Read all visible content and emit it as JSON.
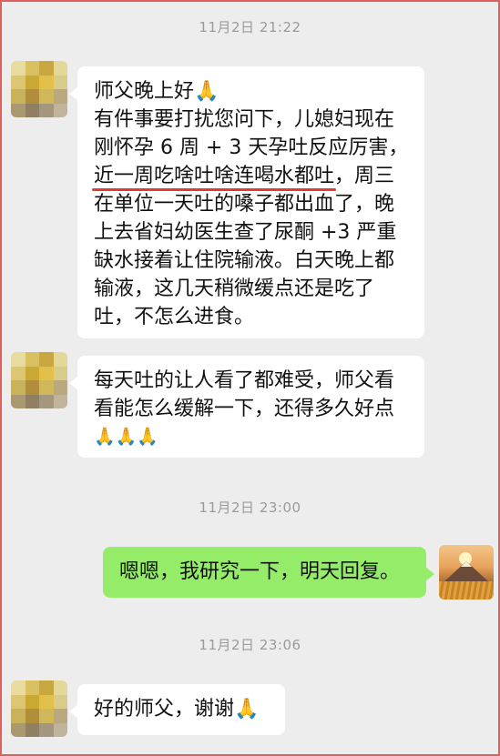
{
  "timestamps": [
    "11月2日 21:22",
    "11月2日 23:00",
    "11月2日 23:06"
  ],
  "messages": [
    {
      "sender": "contact",
      "lines": [
        "师父晚上好🙏",
        "有件事要打扰您问下，儿媳妇现在",
        "刚怀孕 6 周 + 3 天孕吐反应厉害，",
        "在单位一天吐的嗓子都出血了，晚",
        "上去省妇幼医生查了尿酮 +3 严重",
        "缺水接着让住院输液。白天晚上都",
        "输液，这几天稍微缓点还是吃了",
        "吐，不怎么进食。"
      ],
      "highlight": "近一周吃啥吐啥连喝水都吐",
      "highlight_suffix": "，周三"
    },
    {
      "sender": "contact",
      "lines": [
        "每天吐的让人看了都难受，师父看",
        "看能怎么缓解一下，还得多久好点",
        "🙏🙏🙏"
      ]
    },
    {
      "sender": "self",
      "lines": [
        "嗯嗯，我研究一下，明天回复。"
      ]
    },
    {
      "sender": "contact",
      "lines": [
        "好的师父，谢谢🙏"
      ]
    }
  ],
  "colors": {
    "background": "#ededed",
    "self_bubble": "#95ec69",
    "contact_bubble": "#ffffff",
    "highlight_underline": "#e53935",
    "frame_border": "#e0605e"
  }
}
